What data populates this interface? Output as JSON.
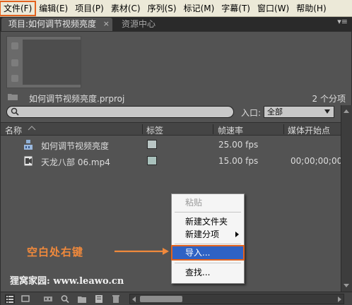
{
  "menubar": {
    "items": [
      "文件(F)",
      "编辑(E)",
      "项目(P)",
      "素材(C)",
      "序列(S)",
      "标记(M)",
      "字幕(T)",
      "窗口(W)",
      "帮助(H)"
    ]
  },
  "tabs": {
    "project": "项目:如何调节视频亮度",
    "close": "×",
    "resource": "资源中心",
    "panel_menu": "▾≡"
  },
  "project": {
    "name": "如何调节视频亮度.prproj",
    "count": "2 个分项",
    "entry_label": "入口:",
    "entry_value": "全部"
  },
  "table": {
    "headers": [
      "名称",
      "标签",
      "帧速率",
      "媒体开始点"
    ],
    "rows": [
      {
        "name": "如何调节视频亮度",
        "fps": "25.00 fps",
        "start": "",
        "label_color": "#b9c5c4",
        "icon": "sequence-icon"
      },
      {
        "name": "天龙八部 06.mp4",
        "fps": "15.00 fps",
        "start": "00;00;00;00",
        "label_color": "#a9c1bc",
        "icon": "video-clip-icon"
      }
    ]
  },
  "context_menu": {
    "paste": "粘贴",
    "new_folder": "新建文件夹",
    "new_item": "新建分项",
    "import": "导入...",
    "find": "查找..."
  },
  "annotation": {
    "text": "空白处右键"
  },
  "watermark": "狸窝家园: www.leawo.cn",
  "colors": {
    "highlight": "#e2631f",
    "menu_selected": "#2f62c4",
    "annotation": "#f0893c"
  }
}
